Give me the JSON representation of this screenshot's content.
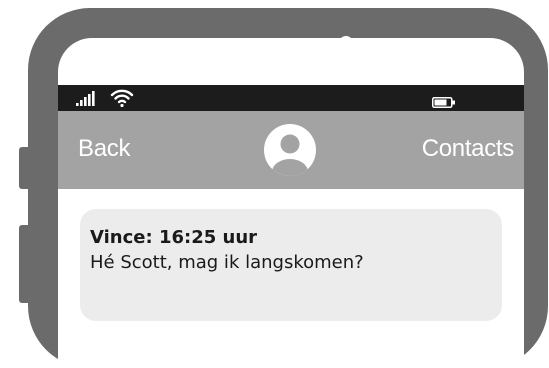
{
  "status_bar": {
    "signal_icon": "signal-bars-icon",
    "wifi_icon": "wifi-icon",
    "battery_icon": "battery-icon"
  },
  "nav": {
    "back_label": "Back",
    "contacts_label": "Contacts",
    "avatar_icon": "user-avatar-icon"
  },
  "message": {
    "sender": "Vince: 16:25 uur",
    "text": "Hé Scott, mag ik langskomen?"
  },
  "colors": {
    "phone_frame": "#6b6b6b",
    "status_bar": "#1c1c1c",
    "nav_bar": "#a3a3a3",
    "bubble": "#ececec"
  }
}
